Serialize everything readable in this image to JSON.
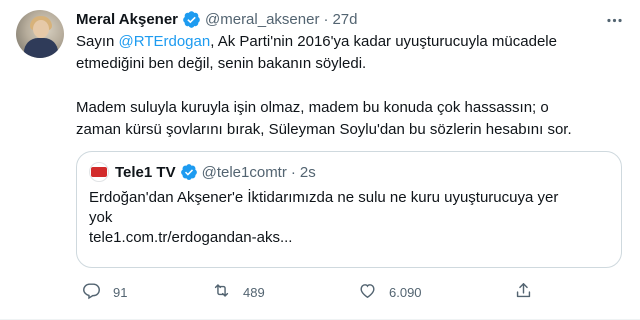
{
  "tweet": {
    "author": {
      "name": "Meral Akşener",
      "handle": "@meral_aksener",
      "separator": "·",
      "time": "27d"
    },
    "text": {
      "p1_prefix": "Sayın ",
      "p1_mention": "@RTErdogan",
      "p1_line1_suffix": ", Ak Parti'nin 2016'ya kadar uyuşturucuyla mücadele",
      "p1_line2": "etmediğini ben değil, senin bakanın söyledi.",
      "p2_line1": "Madem suluyla kuruyla işin olmaz, madem bu konuda çok hassassın; o",
      "p2_line2": "zaman kürsü şovlarını bırak, Süleyman Soylu'dan bu sözlerin hesabını sor."
    },
    "quote": {
      "name": "Tele1 TV",
      "handle": "@tele1comtr",
      "separator": "·",
      "time": "2s",
      "line1": "Erdoğan'dan Akşener'e İktidarımızda ne sulu ne kuru uyuşturucuya yer",
      "line2": "yok",
      "link": "tele1.com.tr/erdogandan-aks..."
    },
    "actions": {
      "replies": "91",
      "retweets": "489",
      "likes": "6.090"
    }
  },
  "colors": {
    "accent": "#1d9bf0",
    "secondary_text": "#536471",
    "border": "#cfd9de"
  },
  "icons": [
    "verified-badge-icon",
    "more-icon",
    "reply-icon",
    "retweet-icon",
    "like-icon",
    "share-icon"
  ]
}
